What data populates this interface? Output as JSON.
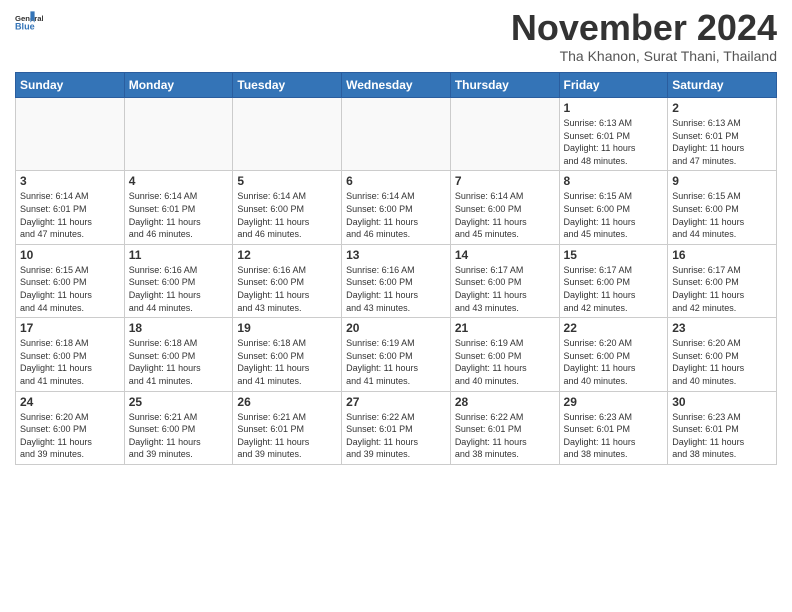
{
  "header": {
    "logo_line1": "General",
    "logo_line2": "Blue",
    "month": "November 2024",
    "location": "Tha Khanon, Surat Thani, Thailand"
  },
  "weekdays": [
    "Sunday",
    "Monday",
    "Tuesday",
    "Wednesday",
    "Thursday",
    "Friday",
    "Saturday"
  ],
  "weeks": [
    [
      {
        "day": "",
        "info": ""
      },
      {
        "day": "",
        "info": ""
      },
      {
        "day": "",
        "info": ""
      },
      {
        "day": "",
        "info": ""
      },
      {
        "day": "",
        "info": ""
      },
      {
        "day": "1",
        "info": "Sunrise: 6:13 AM\nSunset: 6:01 PM\nDaylight: 11 hours\nand 48 minutes."
      },
      {
        "day": "2",
        "info": "Sunrise: 6:13 AM\nSunset: 6:01 PM\nDaylight: 11 hours\nand 47 minutes."
      }
    ],
    [
      {
        "day": "3",
        "info": "Sunrise: 6:14 AM\nSunset: 6:01 PM\nDaylight: 11 hours\nand 47 minutes."
      },
      {
        "day": "4",
        "info": "Sunrise: 6:14 AM\nSunset: 6:01 PM\nDaylight: 11 hours\nand 46 minutes."
      },
      {
        "day": "5",
        "info": "Sunrise: 6:14 AM\nSunset: 6:00 PM\nDaylight: 11 hours\nand 46 minutes."
      },
      {
        "day": "6",
        "info": "Sunrise: 6:14 AM\nSunset: 6:00 PM\nDaylight: 11 hours\nand 46 minutes."
      },
      {
        "day": "7",
        "info": "Sunrise: 6:14 AM\nSunset: 6:00 PM\nDaylight: 11 hours\nand 45 minutes."
      },
      {
        "day": "8",
        "info": "Sunrise: 6:15 AM\nSunset: 6:00 PM\nDaylight: 11 hours\nand 45 minutes."
      },
      {
        "day": "9",
        "info": "Sunrise: 6:15 AM\nSunset: 6:00 PM\nDaylight: 11 hours\nand 44 minutes."
      }
    ],
    [
      {
        "day": "10",
        "info": "Sunrise: 6:15 AM\nSunset: 6:00 PM\nDaylight: 11 hours\nand 44 minutes."
      },
      {
        "day": "11",
        "info": "Sunrise: 6:16 AM\nSunset: 6:00 PM\nDaylight: 11 hours\nand 44 minutes."
      },
      {
        "day": "12",
        "info": "Sunrise: 6:16 AM\nSunset: 6:00 PM\nDaylight: 11 hours\nand 43 minutes."
      },
      {
        "day": "13",
        "info": "Sunrise: 6:16 AM\nSunset: 6:00 PM\nDaylight: 11 hours\nand 43 minutes."
      },
      {
        "day": "14",
        "info": "Sunrise: 6:17 AM\nSunset: 6:00 PM\nDaylight: 11 hours\nand 43 minutes."
      },
      {
        "day": "15",
        "info": "Sunrise: 6:17 AM\nSunset: 6:00 PM\nDaylight: 11 hours\nand 42 minutes."
      },
      {
        "day": "16",
        "info": "Sunrise: 6:17 AM\nSunset: 6:00 PM\nDaylight: 11 hours\nand 42 minutes."
      }
    ],
    [
      {
        "day": "17",
        "info": "Sunrise: 6:18 AM\nSunset: 6:00 PM\nDaylight: 11 hours\nand 41 minutes."
      },
      {
        "day": "18",
        "info": "Sunrise: 6:18 AM\nSunset: 6:00 PM\nDaylight: 11 hours\nand 41 minutes."
      },
      {
        "day": "19",
        "info": "Sunrise: 6:18 AM\nSunset: 6:00 PM\nDaylight: 11 hours\nand 41 minutes."
      },
      {
        "day": "20",
        "info": "Sunrise: 6:19 AM\nSunset: 6:00 PM\nDaylight: 11 hours\nand 41 minutes."
      },
      {
        "day": "21",
        "info": "Sunrise: 6:19 AM\nSunset: 6:00 PM\nDaylight: 11 hours\nand 40 minutes."
      },
      {
        "day": "22",
        "info": "Sunrise: 6:20 AM\nSunset: 6:00 PM\nDaylight: 11 hours\nand 40 minutes."
      },
      {
        "day": "23",
        "info": "Sunrise: 6:20 AM\nSunset: 6:00 PM\nDaylight: 11 hours\nand 40 minutes."
      }
    ],
    [
      {
        "day": "24",
        "info": "Sunrise: 6:20 AM\nSunset: 6:00 PM\nDaylight: 11 hours\nand 39 minutes."
      },
      {
        "day": "25",
        "info": "Sunrise: 6:21 AM\nSunset: 6:00 PM\nDaylight: 11 hours\nand 39 minutes."
      },
      {
        "day": "26",
        "info": "Sunrise: 6:21 AM\nSunset: 6:01 PM\nDaylight: 11 hours\nand 39 minutes."
      },
      {
        "day": "27",
        "info": "Sunrise: 6:22 AM\nSunset: 6:01 PM\nDaylight: 11 hours\nand 39 minutes."
      },
      {
        "day": "28",
        "info": "Sunrise: 6:22 AM\nSunset: 6:01 PM\nDaylight: 11 hours\nand 38 minutes."
      },
      {
        "day": "29",
        "info": "Sunrise: 6:23 AM\nSunset: 6:01 PM\nDaylight: 11 hours\nand 38 minutes."
      },
      {
        "day": "30",
        "info": "Sunrise: 6:23 AM\nSunset: 6:01 PM\nDaylight: 11 hours\nand 38 minutes."
      }
    ]
  ]
}
